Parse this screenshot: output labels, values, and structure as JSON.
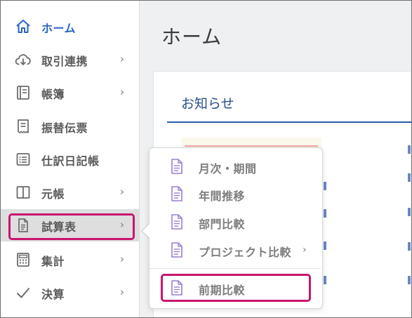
{
  "page": {
    "title": "ホーム"
  },
  "sidebar": {
    "items": [
      {
        "label": "ホーム",
        "icon": "home-icon",
        "chevron": "",
        "active": true
      },
      {
        "label": "取引連携",
        "icon": "cloud-download-icon",
        "chevron": "›"
      },
      {
        "label": "帳簿",
        "icon": "book-icon",
        "chevron": "›"
      },
      {
        "label": "振替伝票",
        "icon": "receipt-icon",
        "chevron": ""
      },
      {
        "label": "仕訳日記帳",
        "icon": "list-icon",
        "chevron": ""
      },
      {
        "label": "元帳",
        "icon": "ledger-icon",
        "chevron": "›"
      },
      {
        "label": "試算表",
        "icon": "document-icon",
        "chevron": "›",
        "selected": true
      },
      {
        "label": "集計",
        "icon": "calculator-icon",
        "chevron": "›"
      },
      {
        "label": "決算",
        "icon": "check-icon",
        "chevron": "›"
      }
    ]
  },
  "notice": {
    "title": "お知らせ"
  },
  "submenu": {
    "items": [
      {
        "label": "月次・期間",
        "icon": "document-icon",
        "chevron": ""
      },
      {
        "label": "年間推移",
        "icon": "document-icon",
        "chevron": ""
      },
      {
        "label": "部門比較",
        "icon": "document-icon",
        "chevron": ""
      },
      {
        "label": "プロジェクト比較",
        "icon": "document-icon",
        "chevron": "›"
      },
      {
        "label": "前期比較",
        "icon": "document-icon",
        "chevron": "",
        "highlighted": true
      }
    ]
  },
  "colors": {
    "accent": "#2a63c3",
    "highlight_border": "#c8166e",
    "submenu_icon": "#9b7fd0",
    "text_muted": "#5a5a5a",
    "selected_bg": "#dedede"
  }
}
